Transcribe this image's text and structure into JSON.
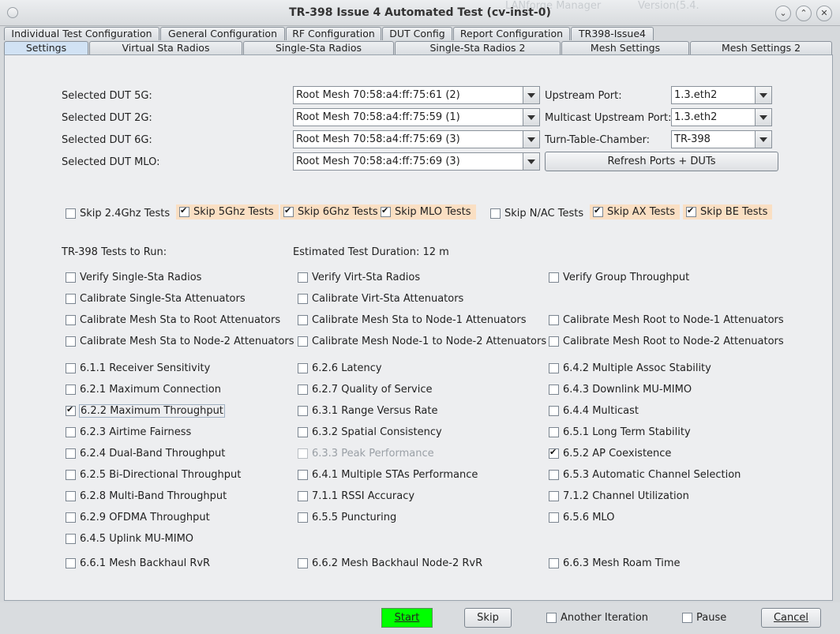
{
  "window": {
    "title": "TR-398 Issue 4 Automated Test  (cv-inst-0)",
    "bg_text_1": "LANforge Manager",
    "bg_text_2": "Version(5.4."
  },
  "tabs_row1": [
    "Individual Test Configuration",
    "General Configuration",
    "RF Configuration",
    "DUT Config",
    "Report Configuration",
    "TR398-Issue4"
  ],
  "tabs_row2": [
    "Settings",
    "Virtual Sta Radios",
    "Single-Sta Radios",
    "Single-Sta Radios 2",
    "Mesh Settings",
    "Mesh Settings 2"
  ],
  "selected_tab": "Settings",
  "dut": {
    "label_5g": "Selected DUT 5G:",
    "value_5g": "Root Mesh 70:58:a4:ff:75:61 (2)",
    "label_2g": "Selected DUT 2G:",
    "value_2g": "Root Mesh 70:58:a4:ff:75:59 (1)",
    "label_6g": "Selected DUT 6G:",
    "value_6g": "Root Mesh 70:58:a4:ff:75:69 (3)",
    "label_mlo": "Selected DUT MLO:",
    "value_mlo": "Root Mesh 70:58:a4:ff:75:69 (3)"
  },
  "ports": {
    "upstream_label": "Upstream Port:",
    "upstream_value": "1.3.eth2",
    "multicast_label": "Multicast Upstream Port:",
    "multicast_value": "1.3.eth2",
    "turntable_label": "Turn-Table-Chamber:",
    "turntable_value": "TR-398",
    "refresh_label": "Refresh Ports + DUTs"
  },
  "skip_options": [
    {
      "label": "Skip 2.4Ghz Tests",
      "checked": false
    },
    {
      "label": "Skip 5Ghz Tests",
      "checked": true
    },
    {
      "label": "Skip 6Ghz Tests",
      "checked": true
    },
    {
      "label": "Skip MLO Tests",
      "checked": true
    },
    {
      "label": "Skip N/AC Tests",
      "checked": false
    },
    {
      "label": "Skip AX Tests",
      "checked": true
    },
    {
      "label": "Skip BE Tests",
      "checked": true
    }
  ],
  "tests_to_run_label": "TR-398 Tests to Run:",
  "estimated_duration": "Estimated Test Duration: 12 m",
  "tests": [
    {
      "label": "Verify Single-Sta Radios",
      "checked": false,
      "disabled": false
    },
    {
      "label": "Verify Virt-Sta Radios",
      "checked": false,
      "disabled": false
    },
    {
      "label": "Verify Group Throughput",
      "checked": false,
      "disabled": false
    },
    {
      "label": "Calibrate Single-Sta Attenuators",
      "checked": false,
      "disabled": false
    },
    {
      "label": "Calibrate Virt-Sta Attenuators",
      "checked": false,
      "disabled": false
    },
    {
      "label": "Calibrate Mesh Sta to Root Attenuators",
      "checked": false,
      "disabled": false
    },
    {
      "label": "Calibrate Mesh Sta to Node-1 Attenuators",
      "checked": false,
      "disabled": false
    },
    {
      "label": "Calibrate Mesh Root to Node-1 Attenuators",
      "checked": false,
      "disabled": false
    },
    {
      "label": "Calibrate Mesh Sta to Node-2 Attenuators",
      "checked": false,
      "disabled": false
    },
    {
      "label": "Calibrate Mesh Node-1 to Node-2 Attenuators",
      "checked": false,
      "disabled": false
    },
    {
      "label": "Calibrate Mesh Root to Node-2 Attenuators",
      "checked": false,
      "disabled": false
    },
    {
      "label": "6.1.1 Receiver Sensitivity",
      "checked": false,
      "disabled": false
    },
    {
      "label": "6.2.6 Latency",
      "checked": false,
      "disabled": false
    },
    {
      "label": "6.4.2 Multiple Assoc Stability",
      "checked": false,
      "disabled": false
    },
    {
      "label": "6.2.1 Maximum Connection",
      "checked": false,
      "disabled": false
    },
    {
      "label": "6.2.7 Quality of Service",
      "checked": false,
      "disabled": false
    },
    {
      "label": "6.4.3 Downlink MU-MIMO",
      "checked": false,
      "disabled": false
    },
    {
      "label": "6.2.2 Maximum Throughput",
      "checked": true,
      "disabled": false
    },
    {
      "label": "6.3.1 Range Versus Rate",
      "checked": false,
      "disabled": false
    },
    {
      "label": "6.4.4 Multicast",
      "checked": false,
      "disabled": false
    },
    {
      "label": "6.2.3 Airtime Fairness",
      "checked": false,
      "disabled": false
    },
    {
      "label": "6.3.2 Spatial Consistency",
      "checked": false,
      "disabled": false
    },
    {
      "label": "6.5.1 Long Term Stability",
      "checked": false,
      "disabled": false
    },
    {
      "label": "6.2.4 Dual-Band Throughput",
      "checked": false,
      "disabled": false
    },
    {
      "label": "6.3.3 Peak Performance",
      "checked": false,
      "disabled": true
    },
    {
      "label": "6.5.2 AP Coexistence",
      "checked": true,
      "disabled": false
    },
    {
      "label": "6.2.5 Bi-Directional Throughput",
      "checked": false,
      "disabled": false
    },
    {
      "label": "6.4.1 Multiple STAs Performance",
      "checked": false,
      "disabled": false
    },
    {
      "label": "6.5.3 Automatic Channel Selection",
      "checked": false,
      "disabled": false
    },
    {
      "label": "6.2.8 Multi-Band Throughput",
      "checked": false,
      "disabled": false
    },
    {
      "label": "7.1.1 RSSI Accuracy",
      "checked": false,
      "disabled": false
    },
    {
      "label": "7.1.2 Channel Utilization",
      "checked": false,
      "disabled": false
    },
    {
      "label": "6.2.9 OFDMA Throughput",
      "checked": false,
      "disabled": false
    },
    {
      "label": "6.5.5 Puncturing",
      "checked": false,
      "disabled": false
    },
    {
      "label": "6.5.6 MLO",
      "checked": false,
      "disabled": false
    },
    {
      "label": "6.4.5 Uplink MU-MIMO",
      "checked": false,
      "disabled": false
    },
    {
      "label": "6.6.1 Mesh Backhaul RvR",
      "checked": false,
      "disabled": false
    },
    {
      "label": "6.6.2 Mesh Backhaul Node-2 RvR",
      "checked": false,
      "disabled": false
    },
    {
      "label": "6.6.3 Mesh Roam Time",
      "checked": false,
      "disabled": false
    }
  ],
  "footer": {
    "start": "Start",
    "skip": "Skip",
    "another_iteration": "Another Iteration",
    "another_iteration_checked": false,
    "pause": "Pause",
    "pause_checked": false,
    "cancel": "Cancel"
  }
}
